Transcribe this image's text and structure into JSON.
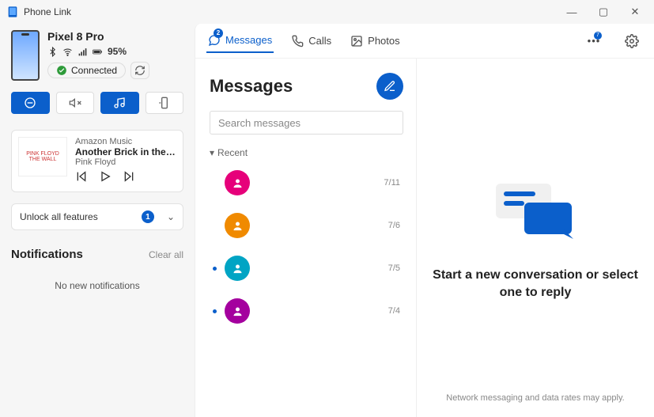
{
  "app": {
    "title": "Phone Link"
  },
  "window_controls": {
    "min": "—",
    "max": "▢",
    "close": "✕"
  },
  "phone": {
    "name": "Pixel 8 Pro",
    "battery_pct": "95%",
    "connected_label": "Connected"
  },
  "quick_actions": {
    "dnd": "dnd-icon",
    "mute": "mute-icon",
    "music": "music-icon",
    "cast": "cast-icon"
  },
  "media": {
    "source": "Amazon Music",
    "track": "Another Brick in the Wall,...",
    "artist": "Pink Floyd",
    "albumText1": "PINK FLOYD",
    "albumText2": "THE WALL"
  },
  "unlock": {
    "label": "Unlock all features",
    "badge": "1"
  },
  "notifications": {
    "title": "Notifications",
    "clear": "Clear all",
    "empty": "No new notifications"
  },
  "nav": {
    "messages": "Messages",
    "messages_badge": "2",
    "calls": "Calls",
    "photos": "Photos",
    "more_badge": "7"
  },
  "messages": {
    "title": "Messages",
    "search_placeholder": "Search messages",
    "recent_label": "Recent",
    "threads": [
      {
        "color": "#e6007a",
        "date": "7/11",
        "unread": false
      },
      {
        "color": "#f08a00",
        "date": "7/6",
        "unread": false
      },
      {
        "color": "#00a4c4",
        "date": "7/5",
        "unread": true
      },
      {
        "color": "#a4009e",
        "date": "7/4",
        "unread": true
      }
    ]
  },
  "empty_state": {
    "heading": "Start a new conversation or select one to reply",
    "footer": "Network messaging and data rates may apply."
  }
}
